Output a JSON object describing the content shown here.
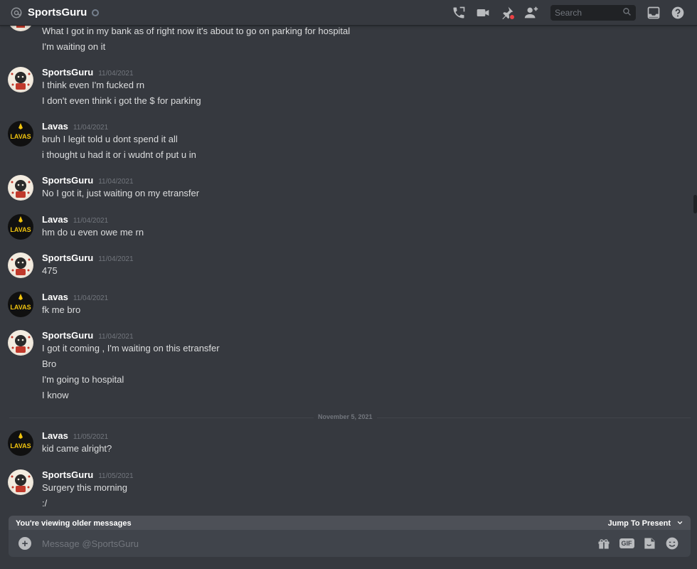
{
  "header": {
    "title": "SportsGuru",
    "search_placeholder": "Search",
    "icons": [
      "at-icon",
      "call-icon",
      "video-icon",
      "pin-icon",
      "add-friend-icon",
      "search-icon",
      "inbox-icon",
      "help-icon"
    ]
  },
  "messages": [
    {
      "lines": [
        "What I got in my bank as of right now it's about to go on parking for hospital",
        "I'm waiting on it"
      ]
    },
    {
      "author": "SportsGuru",
      "timestamp": "11/04/2021",
      "lines": [
        "I think even I'm fucked rn",
        "I don't even think i got the $ for parking"
      ]
    },
    {
      "author": "Lavas",
      "timestamp": "11/04/2021",
      "lines": [
        "bruh I legit told u dont spend it all",
        "i thought u had it or i wudnt of put u in"
      ]
    },
    {
      "author": "SportsGuru",
      "timestamp": "11/04/2021",
      "lines": [
        "No I got it, just waiting on my etransfer"
      ]
    },
    {
      "author": "Lavas",
      "timestamp": "11/04/2021",
      "lines": [
        "hm do u even owe me rn"
      ]
    },
    {
      "author": "SportsGuru",
      "timestamp": "11/04/2021",
      "lines": [
        "475"
      ]
    },
    {
      "author": "Lavas",
      "timestamp": "11/04/2021",
      "lines": [
        "fk me bro"
      ]
    },
    {
      "author": "SportsGuru",
      "timestamp": "11/04/2021",
      "lines": [
        "I got it coming , I'm waiting on this etransfer",
        "Bro",
        "I'm going to hospital",
        "I know"
      ]
    },
    {
      "author": "Lavas",
      "timestamp": "11/05/2021",
      "lines": [
        "kid came alright?"
      ]
    },
    {
      "author": "SportsGuru",
      "timestamp": "11/05/2021",
      "lines": [
        "Surgery this morning",
        ":/"
      ]
    }
  ],
  "divider": {
    "label": "November 5, 2021"
  },
  "older_bar": {
    "label": "You're viewing older messages",
    "jump_label": "Jump To Present"
  },
  "composer": {
    "placeholder": "Message @SportsGuru",
    "gif_label": "GIF"
  },
  "avatar_text": {
    "lavas": "LAVAS"
  },
  "colors": {
    "background": "#36393f",
    "composer": "#40444b",
    "older_bar": "#4d5057",
    "timestamp": "#72767d",
    "author": "#ffffff"
  }
}
